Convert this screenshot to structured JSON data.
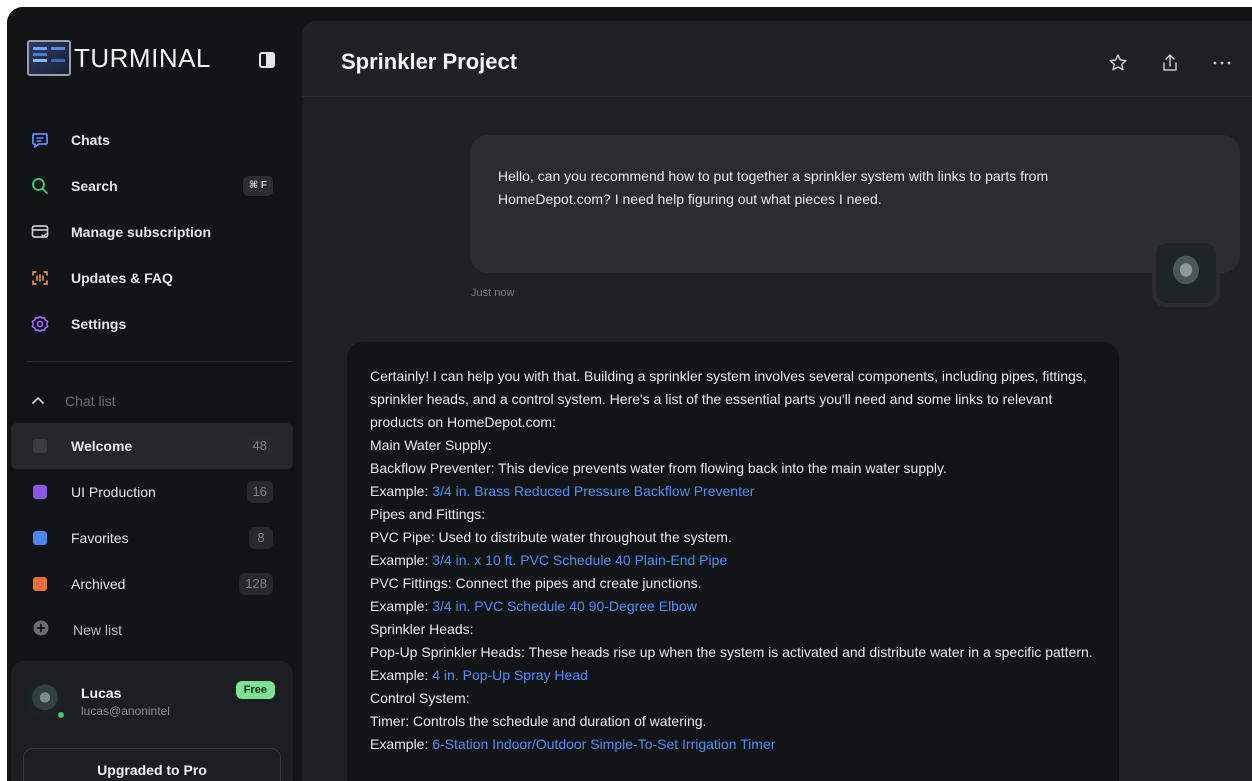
{
  "brand": {
    "name": "TURMINAL"
  },
  "nav": {
    "items": [
      {
        "label": "Chats",
        "icon": "chat-bubble-icon",
        "color": "#5b8cff"
      },
      {
        "label": "Search",
        "icon": "search-icon",
        "color": "#3fc56b",
        "shortcut": "⌘ F"
      },
      {
        "label": "Manage subscription",
        "icon": "subscription-card-icon",
        "color": "#c9c9cf"
      },
      {
        "label": "Updates & FAQ",
        "icon": "updates-icon",
        "color": "#e8894a"
      },
      {
        "label": "Settings",
        "icon": "gear-icon",
        "color": "#9b6cff"
      }
    ]
  },
  "chat_list": {
    "header": "Chat list",
    "items": [
      {
        "label": "Welcome",
        "count": "48",
        "color": "#3a3c41"
      },
      {
        "label": "UI Production",
        "count": "16",
        "color": "#8b55e6"
      },
      {
        "label": "Favorites",
        "count": "8",
        "color": "#4d86f0"
      },
      {
        "label": "Archived",
        "count": "128",
        "color": "#e8703a"
      }
    ],
    "new_list": "New list"
  },
  "user": {
    "name": "Lucas",
    "email": "lucas@anonintel",
    "plan_badge": "Free",
    "upgrade_label": "Upgraded to Pro"
  },
  "header": {
    "title": "Sprinkler Project"
  },
  "messages": {
    "user_text": "Hello, can you recommend how to put together a sprinkler system with links to parts from HomeDepot.com? I need help figuring out what pieces I need.",
    "timestamp": "Just now",
    "bot_lines": [
      {
        "text": "Certainly! I can help you with that. Building a sprinkler system involves several components, including pipes, fittings, sprinkler heads, and a control system. Here's a list of the essential parts you'll need and some links to relevant products on HomeDepot.com:"
      },
      {
        "text": "Main Water Supply:"
      },
      {
        "text": "Backflow Preventer: This device prevents water from flowing back into the main water supply."
      },
      {
        "text": "Example: ",
        "link": "3/4 in. Brass Reduced Pressure Backflow Preventer"
      },
      {
        "text": "Pipes and Fittings:"
      },
      {
        "text": "PVC Pipe: Used to distribute water throughout the system."
      },
      {
        "text": "Example: ",
        "link": "3/4 in. x 10 ft. PVC Schedule 40 Plain-End Pipe"
      },
      {
        "text": "PVC Fittings: Connect the pipes and create junctions."
      },
      {
        "text": "Example: ",
        "link": "3/4 in. PVC Schedule 40 90-Degree Elbow"
      },
      {
        "text": "Sprinkler Heads:"
      },
      {
        "text": "Pop-Up Sprinkler Heads: These heads rise up when the system is activated and distribute water in a specific pattern."
      },
      {
        "text": "Example: ",
        "link": "4 in. Pop-Up Spray Head"
      },
      {
        "text": "Control System:"
      },
      {
        "text": "Timer: Controls the schedule and duration of watering."
      },
      {
        "text": "Example: ",
        "link": "6-Station Indoor/Outdoor Simple-To-Set Irrigation Timer"
      }
    ]
  }
}
